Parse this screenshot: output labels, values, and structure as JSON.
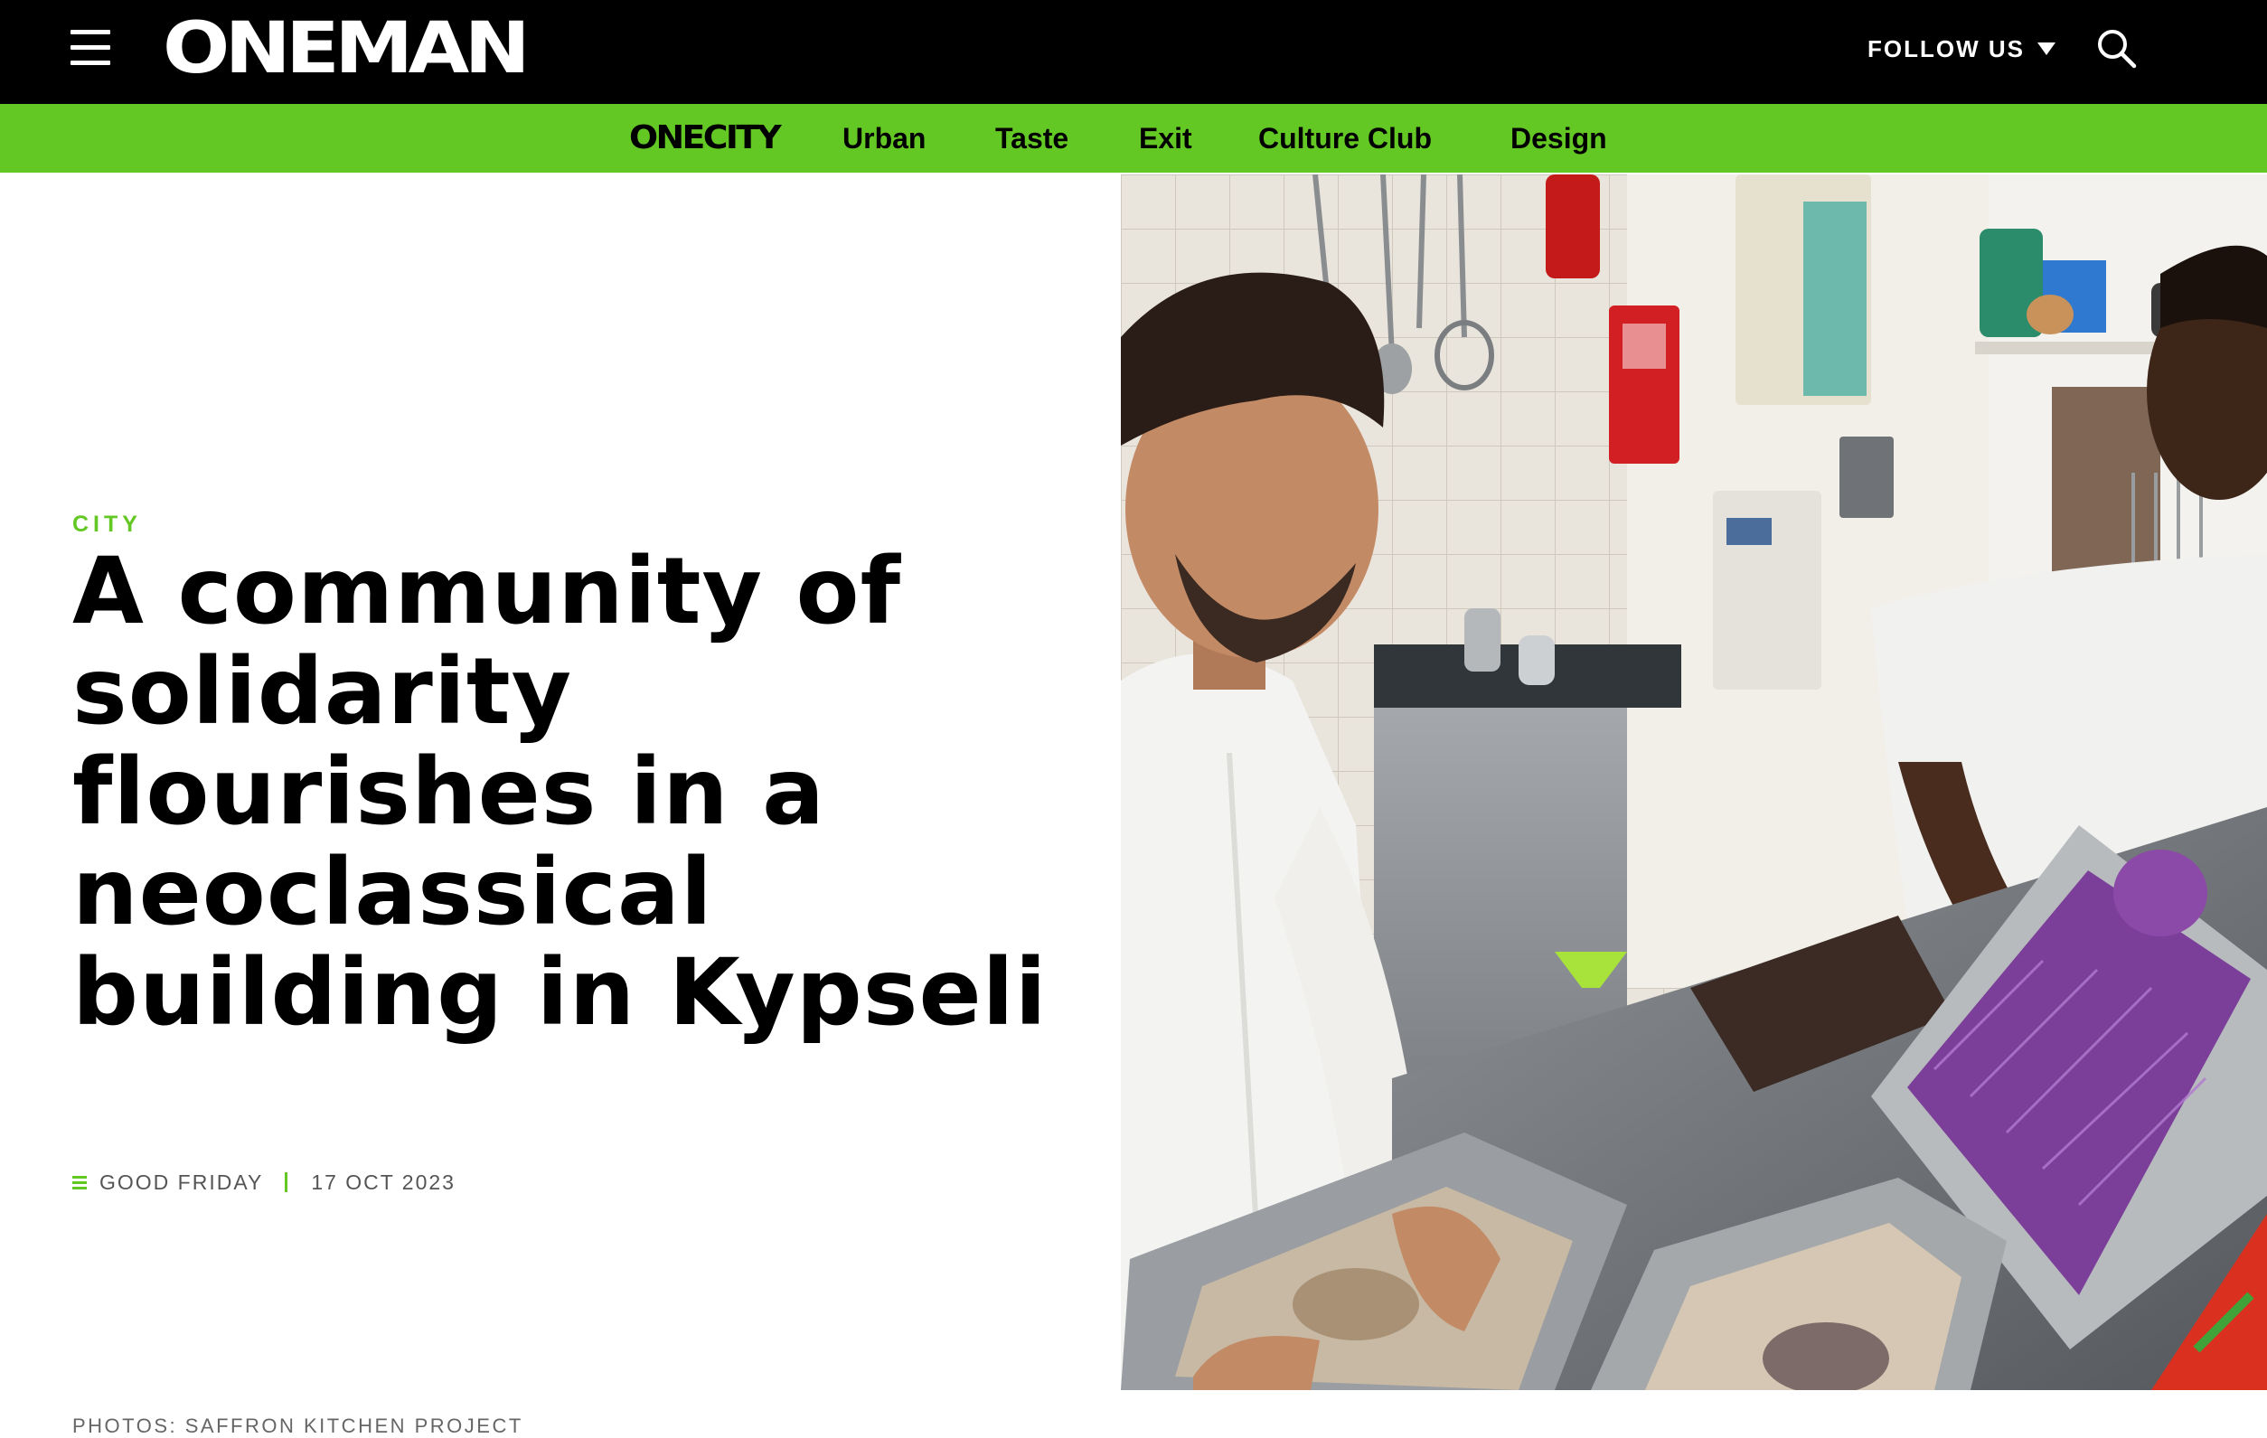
{
  "header": {
    "logo_text": "ONEMAN",
    "follow_label": "FOLLOW US",
    "background_color": "#000000"
  },
  "nav": {
    "brand": "ONECITY",
    "background_color": "#64c824",
    "links": [
      {
        "label": "Urban"
      },
      {
        "label": "Taste"
      },
      {
        "label": "Exit"
      },
      {
        "label": "Culture Club"
      },
      {
        "label": "Design"
      }
    ]
  },
  "article": {
    "category": "CITY",
    "title": "A community of solidarity flourishes in a neoclassical building in Kypseli",
    "author": "GOOD FRIDAY",
    "date": "17 OCT 2023",
    "credit": "PHOTOS: SAFFRON KITCHEN PROJECT",
    "accent_color": "#64c824"
  },
  "icons": {
    "menu": "hamburger-menu-icon",
    "search": "search-icon",
    "dropdown": "caret-down-icon",
    "author": "author-lines-icon"
  }
}
